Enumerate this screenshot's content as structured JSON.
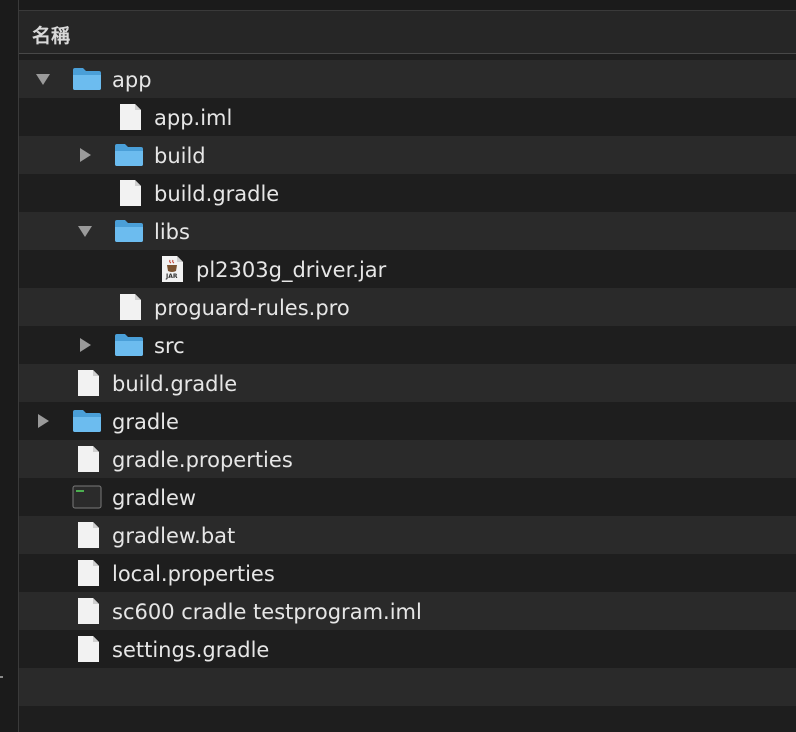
{
  "header": {
    "column_name": "名稱"
  },
  "rows": [
    {
      "label": "app",
      "type": "folder",
      "disclosure": "expanded"
    },
    {
      "label": "app.iml",
      "type": "file"
    },
    {
      "label": "build",
      "type": "folder",
      "disclosure": "collapsed"
    },
    {
      "label": "build.gradle",
      "type": "file"
    },
    {
      "label": "libs",
      "type": "folder",
      "disclosure": "expanded"
    },
    {
      "label": "pl2303g_driver.jar",
      "type": "jar",
      "icon_text": "JAR"
    },
    {
      "label": "proguard-rules.pro",
      "type": "file"
    },
    {
      "label": "src",
      "type": "folder",
      "disclosure": "collapsed"
    },
    {
      "label": "build.gradle",
      "type": "file"
    },
    {
      "label": "gradle",
      "type": "folder",
      "disclosure": "collapsed"
    },
    {
      "label": "gradle.properties",
      "type": "file"
    },
    {
      "label": "gradlew",
      "type": "executable"
    },
    {
      "label": "gradlew.bat",
      "type": "file"
    },
    {
      "label": "local.properties",
      "type": "file"
    },
    {
      "label": "sc600 cradle testprogram.iml",
      "type": "file"
    },
    {
      "label": "settings.gradle",
      "type": "file"
    }
  ],
  "colors": {
    "background": "#1e1e1e",
    "row_alt": "#2a2a2a",
    "folder_blue": "#5fb2e6",
    "text": "#e6e6e6"
  }
}
